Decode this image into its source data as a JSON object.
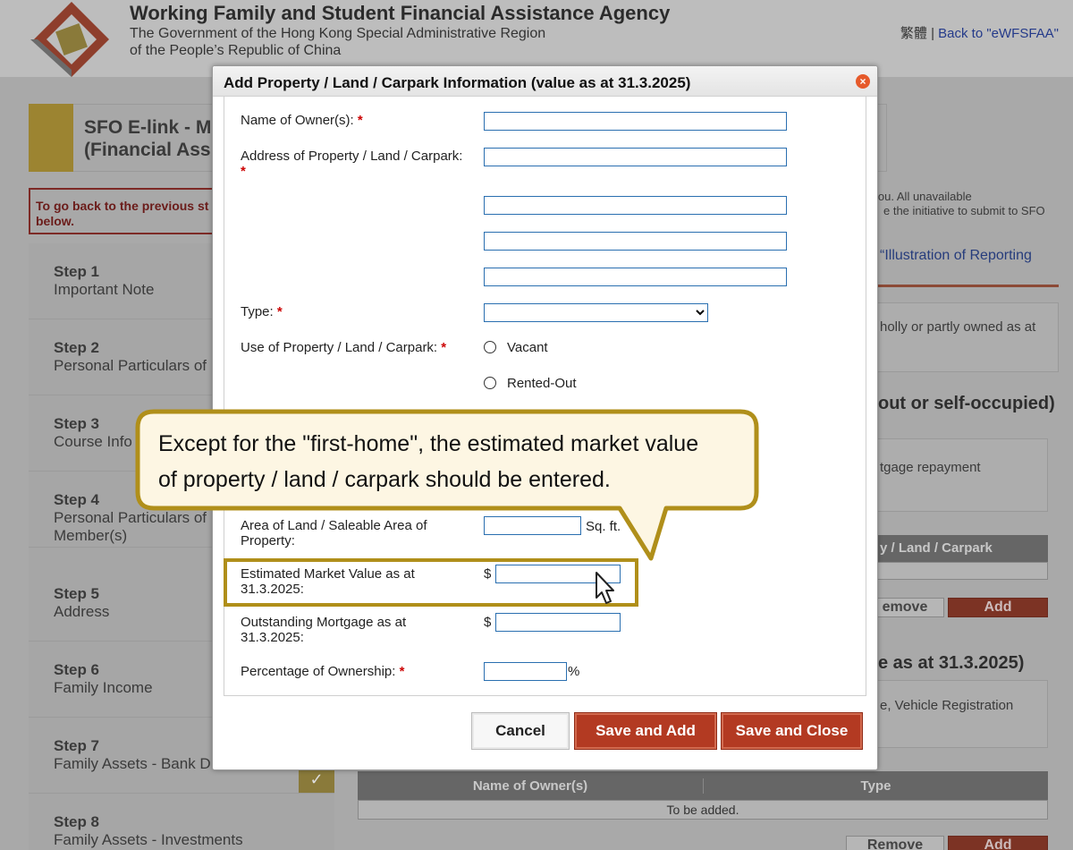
{
  "header": {
    "agency_title": "Working Family and Student Financial Assistance Agency",
    "agency_sub1": "The Government of the Hong Kong Special Administrative Region",
    "agency_sub2": "of the People’s Republic of China",
    "lang_link": "繁體",
    "separator": "|",
    "back_link": "Back to \"eWFSFAA\""
  },
  "background": {
    "sfo_title_1": "SFO E-link - M",
    "sfo_title_2": "(Financial Assis",
    "warning_1": "To go back to the previous st",
    "warning_2": "below.",
    "steps": [
      {
        "num": "Step 1",
        "name": "Important Note"
      },
      {
        "num": "Step 2",
        "name": "Personal Particulars of"
      },
      {
        "num": "Step 3",
        "name": "Course Info"
      },
      {
        "num": "Step 4",
        "name": "Personal Particulars of",
        "name2": "Member(s)"
      },
      {
        "num": "Step 5",
        "name": "Address"
      },
      {
        "num": "Step 6",
        "name": "Family Income"
      },
      {
        "num": "Step 7",
        "name": "Family Assets - Bank D"
      },
      {
        "num": "Step 8",
        "name": "Family Assets - Investments"
      }
    ],
    "right_note_1": "ble to you. All unavailable",
    "right_note_2": "e the initiative to submit to SFO",
    "right_link": "“Illustration of Reporting",
    "right_box1": "holly or partly owned as at",
    "right_heading1": "out or self-occupied)",
    "right_box2": "tgage repayment",
    "right_thead": "y / Land / Carpark",
    "remove_label": "Remove",
    "remove_label_cut": "emove",
    "add_label": "Add",
    "right_heading2": "e as at 31.3.2025)",
    "right_box3": "e, Vehicle Registration",
    "table_col1": "Name of Owner(s)",
    "table_col2": "Type",
    "table_empty": "To be added."
  },
  "modal": {
    "title": "Add Property / Land / Carpark Information (value as at 31.3.2025)",
    "close_glyph": "×",
    "required_mark": "*",
    "fields": {
      "owner_label": "Name of Owner(s):",
      "owner_value": "",
      "address_label": "Address of Property / Land / Carpark:",
      "address_values": [
        "",
        "",
        "",
        ""
      ],
      "type_label": "Type:",
      "type_value": "",
      "use_label": "Use of Property / Land / Carpark:",
      "use_options": [
        "Vacant",
        "Rented-Out"
      ],
      "area_label_1": "Area of Land / Saleable Area of",
      "area_label_2": "Property:",
      "area_value": "",
      "area_unit": "Sq. ft.",
      "market_label_1": "Estimated Market Value as at",
      "market_label_2": "31.3.2025:",
      "market_value": "",
      "currency": "$",
      "mortgage_label_1": "Outstanding Mortgage as at",
      "mortgage_label_2": "31.3.2025:",
      "mortgage_value": "",
      "ownership_label": "Percentage of Ownership:",
      "ownership_value": "",
      "percent_unit": "%"
    },
    "buttons": {
      "cancel": "Cancel",
      "save_add": "Save and Add",
      "save_close": "Save and Close"
    }
  },
  "callout": {
    "line1": "Except for the \"first-home\", the estimated market value",
    "line2": "of property / land / carpark should be entered."
  },
  "colors": {
    "accent_red": "#b33a22",
    "callout_border": "#b08f1a",
    "callout_fill": "#fdf6e3",
    "input_border": "#2a6fb0"
  }
}
